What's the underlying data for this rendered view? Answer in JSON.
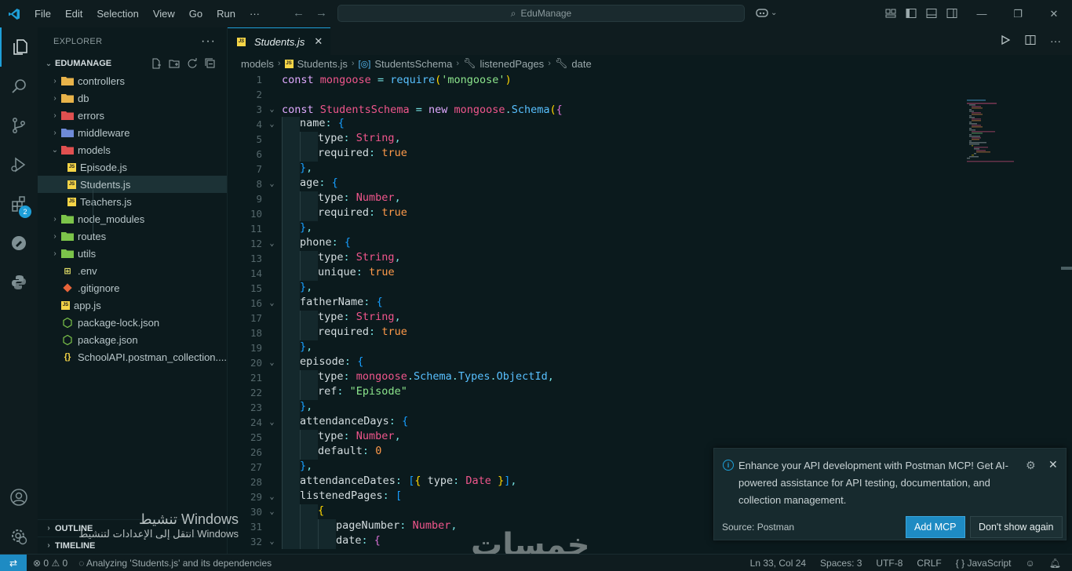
{
  "titlebar": {
    "menu": [
      "File",
      "Edit",
      "Selection",
      "View",
      "Go",
      "Run",
      "···"
    ],
    "search_placeholder": "EduManage",
    "logo_icon": "vscode-logo-icon",
    "accent": "#1e9fd8"
  },
  "activitybar": {
    "extensions_badge": "2"
  },
  "sidebar": {
    "title": "EXPLORER",
    "more": "···",
    "folder_name": "EDUMANAGE",
    "items": [
      {
        "label": "controllers",
        "type": "folder",
        "open": false,
        "icon": "folder-controllers-icon"
      },
      {
        "label": "db",
        "type": "folder",
        "open": false,
        "icon": "folder-db-icon"
      },
      {
        "label": "errors",
        "type": "folder",
        "open": false,
        "icon": "folder-errors-icon"
      },
      {
        "label": "middleware",
        "type": "folder",
        "open": false,
        "icon": "folder-middleware-icon"
      },
      {
        "label": "models",
        "type": "folder",
        "open": true,
        "icon": "folder-models-icon"
      },
      {
        "label": "Episode.js",
        "type": "file",
        "depth": 2,
        "icon": "js-file-icon"
      },
      {
        "label": "Students.js",
        "type": "file",
        "depth": 2,
        "selected": true,
        "icon": "js-file-icon"
      },
      {
        "label": "Teachers.js",
        "type": "file",
        "depth": 2,
        "icon": "js-file-icon"
      },
      {
        "label": "node_modules",
        "type": "folder",
        "open": false,
        "icon": "folder-node-icon"
      },
      {
        "label": "routes",
        "type": "folder",
        "open": false,
        "icon": "folder-routes-icon"
      },
      {
        "label": "utils",
        "type": "folder",
        "open": false,
        "icon": "folder-utils-icon"
      },
      {
        "label": ".env",
        "type": "file",
        "depth": 1,
        "icon": "env-file-icon"
      },
      {
        "label": ".gitignore",
        "type": "file",
        "depth": 1,
        "icon": "git-file-icon"
      },
      {
        "label": "app.js",
        "type": "file",
        "depth": 1,
        "icon": "js-file-icon"
      },
      {
        "label": "package-lock.json",
        "type": "file",
        "depth": 1,
        "icon": "nodejs-file-icon"
      },
      {
        "label": "package.json",
        "type": "file",
        "depth": 1,
        "icon": "nodejs-file-icon"
      },
      {
        "label": "SchoolAPI.postman_collection....",
        "type": "file",
        "depth": 1,
        "icon": "json-file-icon"
      }
    ],
    "outline_label": "OUTLINE",
    "timeline_label": "TIMELINE"
  },
  "editor": {
    "tab_label": "Students.js",
    "tab_close": "✕",
    "breadcrumb": [
      "models",
      "Students.js",
      "StudentsSchema",
      "listenedPages",
      "date"
    ]
  },
  "notification": {
    "message": "Enhance your API development with Postman MCP! Get AI-powered assistance for API testing, documentation, and collection management.",
    "source": "Source: Postman",
    "primary_button": "Add MCP",
    "secondary_button": "Don't show again"
  },
  "statusbar": {
    "errors": "0",
    "warnings": "0",
    "analyzing": "Analyzing 'Students.js' and its dependencies",
    "position": "Ln 33, Col 24",
    "spaces": "Spaces: 3",
    "encoding": "UTF-8",
    "eol": "CRLF",
    "language": "JavaScript"
  },
  "watermarks": {
    "windows_line1": "تنشيط Windows",
    "windows_line2": "انتقل إلى الإعدادات لتنشيط Windows",
    "site": "خمسات"
  }
}
